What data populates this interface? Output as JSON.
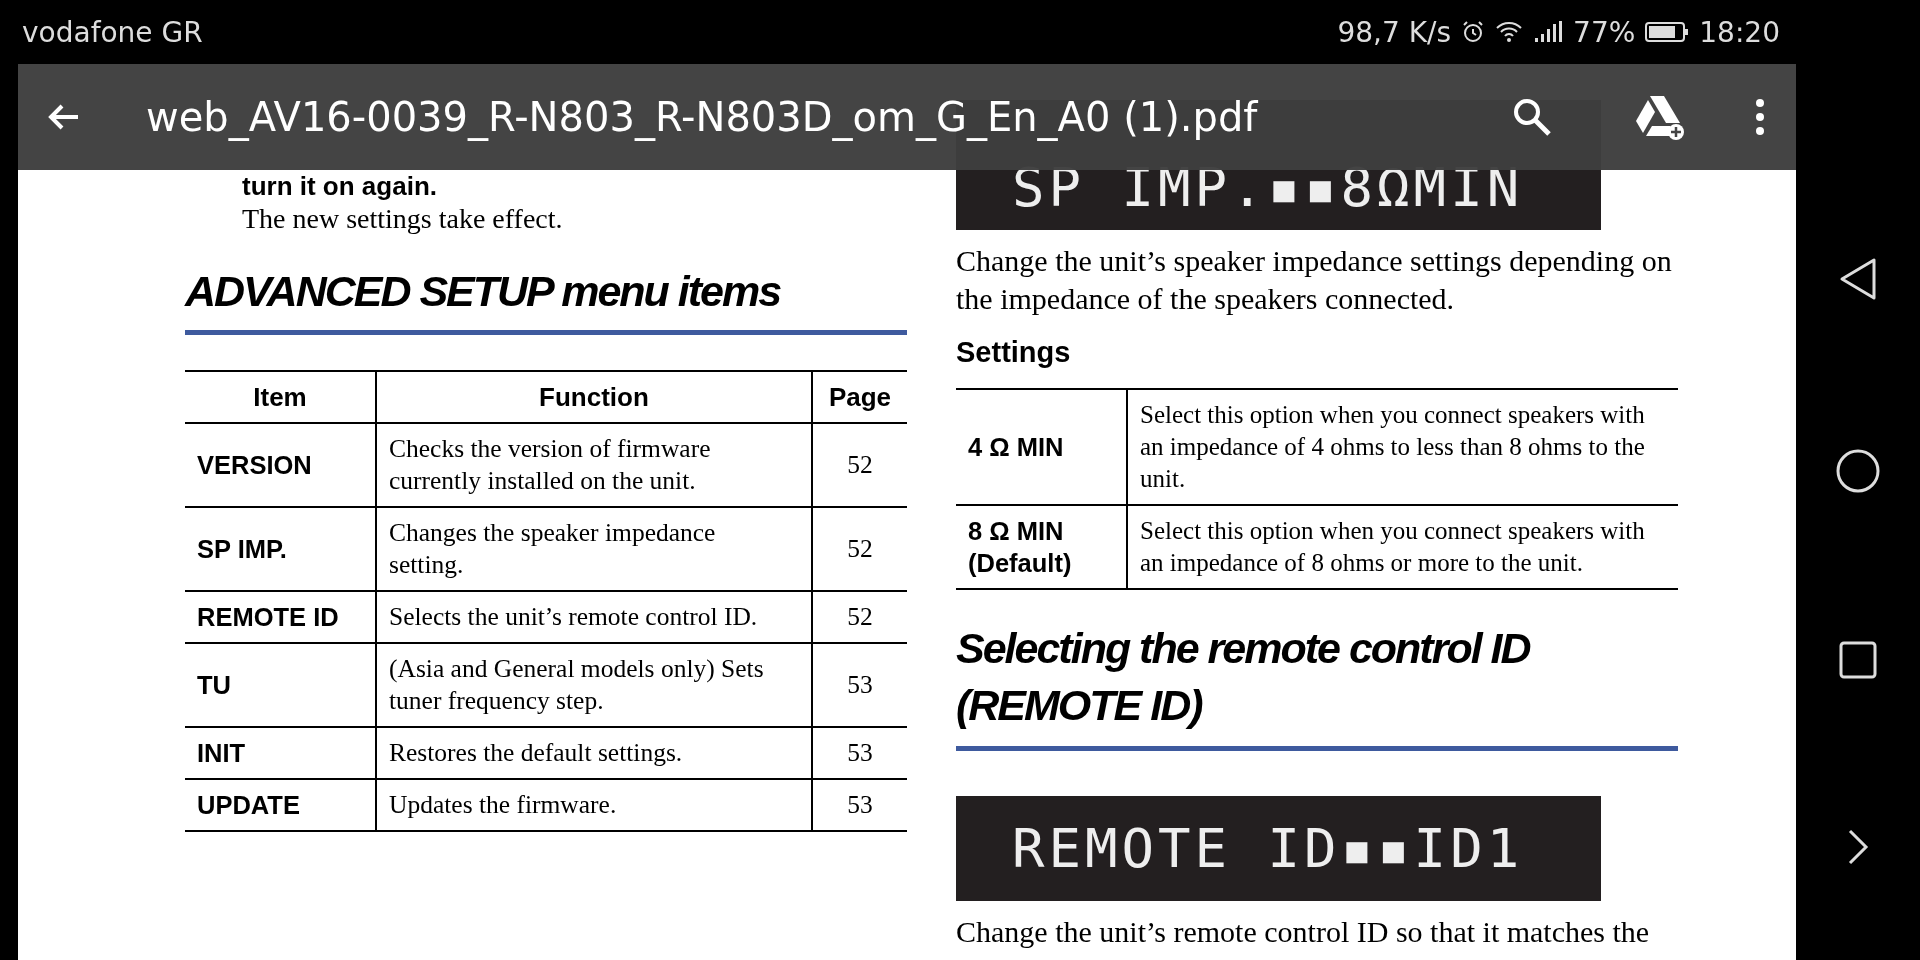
{
  "status_bar": {
    "carrier": "vodafone GR",
    "net_speed": "98,7 K/s",
    "battery_percent": "77%",
    "time": "18:20"
  },
  "toolbar": {
    "title": "web_AV16-0039_R-N803_R-N803D_om_G_En_A0 (1).pdf"
  },
  "document": {
    "left": {
      "step_text": "turn it on again.",
      "result_text": "The new settings take effect.",
      "heading": "ADVANCED SETUP menu items",
      "table": {
        "columns": [
          "Item",
          "Function",
          "Page"
        ],
        "rows": [
          {
            "item": "VERSION",
            "function": "Checks the version of firmware currently installed on the unit.",
            "page": "52"
          },
          {
            "item": "SP IMP.",
            "function": "Changes the speaker impedance setting.",
            "page": "52"
          },
          {
            "item": "REMOTE ID",
            "function": "Selects the unit’s remote control ID.",
            "page": "52"
          },
          {
            "item": "TU",
            "function": "(Asia and General models only) Sets tuner frequency step.",
            "page": "53"
          },
          {
            "item": "INIT",
            "function": "Restores the default settings.",
            "page": "53"
          },
          {
            "item": "UPDATE",
            "function": "Updates the firmware.",
            "page": "53"
          }
        ]
      }
    },
    "right": {
      "display_1": "SP IMP.▪▪8ΩMIN",
      "paragraph_1": "Change the unit’s speaker impedance settings depending on the impedance of the speakers connected.",
      "settings_heading": "Settings",
      "settings_table": {
        "rows": [
          {
            "option": "4 Ω MIN",
            "description": "Select this option when you connect speakers with an impedance of 4 ohms to less than 8 ohms to the unit."
          },
          {
            "option": "8 Ω MIN (Default)",
            "description": "Select this option when you connect speakers with an impedance of 8 ohms or more to the unit."
          }
        ]
      },
      "heading": "Selecting the remote control ID (REMOTE ID)",
      "display_2": "REMOTE ID▪▪ID1",
      "paragraph_2": "Change the unit’s remote control ID so that it matches the"
    }
  }
}
